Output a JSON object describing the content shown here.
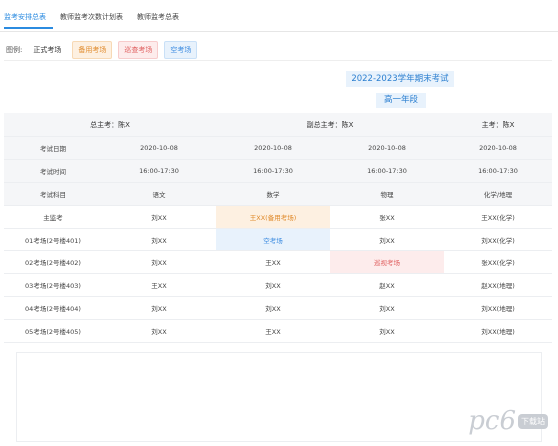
{
  "tabs": [
    {
      "label": "监考安排总表",
      "active": true
    },
    {
      "label": "教师监考次数计划表",
      "active": false
    },
    {
      "label": "教师监考总表",
      "active": false
    }
  ],
  "legend": {
    "label": "图例:",
    "items": [
      "正式考场",
      "备用考场",
      "巡查考场",
      "空考场"
    ]
  },
  "title": "2022-2023学年期末考试",
  "grade": "高一年段",
  "header": {
    "chief": "总主考：陈X",
    "vice_chief": "副总主考：陈X",
    "main": "主考：陈X"
  },
  "rows": [
    {
      "label": "考试日期",
      "cells": [
        "2020-10-08",
        "2020-10-08",
        "2020-10-08",
        "2020-10-08"
      ],
      "shaded": true
    },
    {
      "label": "考试时间",
      "cells": [
        "16:00-17:30",
        "16:00-17:30",
        "16:00-17:30",
        "16:00-17:30"
      ],
      "shaded": true
    },
    {
      "label": "考试科目",
      "cells": [
        "语文",
        "数学",
        "物理",
        "化学/地理"
      ],
      "shaded": true
    },
    {
      "label": "主监考",
      "cells": [
        "刘XX",
        "王XX(备用考场)",
        "张XX",
        "王XX(化学)"
      ],
      "styles": [
        "",
        "backup",
        "",
        ""
      ]
    },
    {
      "label": "01考场(2号楼401)",
      "cells": [
        "刘XX",
        "空考场",
        "刘XX",
        "刘XX(化学)"
      ],
      "styles": [
        "",
        "empty",
        "",
        ""
      ]
    },
    {
      "label": "02考场(2号楼402)",
      "cells": [
        "刘XX",
        "王XX",
        "巡视考场",
        "张XX(化学)"
      ],
      "styles": [
        "",
        "",
        "inspect",
        ""
      ]
    },
    {
      "label": "03考场(2号楼403)",
      "cells": [
        "王XX",
        "刘XX",
        "赵XX",
        "赵XX(地理)"
      ]
    },
    {
      "label": "04考场(2号楼404)",
      "cells": [
        "刘XX",
        "刘XX",
        "刘XX",
        "刘XX(地理)"
      ]
    },
    {
      "label": "05考场(2号楼405)",
      "cells": [
        "刘XX",
        "王XX",
        "刘XX",
        "刘XX(地理)"
      ]
    }
  ],
  "watermark": {
    "brand": "pc6",
    "badge": "下载站"
  }
}
